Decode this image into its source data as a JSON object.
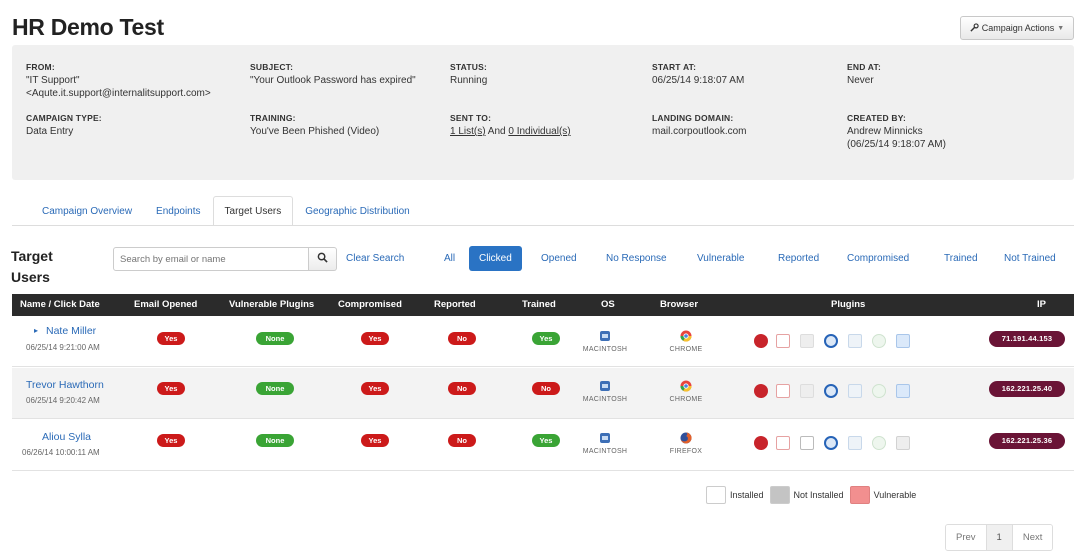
{
  "page": {
    "title": "HR Demo Test",
    "actions_label": "Campaign Actions"
  },
  "info": {
    "from_label": "FROM:",
    "from_value_1": "\"IT Support\"",
    "from_value_2": "<Aqute.it.support@internalitsupport.com>",
    "subject_label": "SUBJECT:",
    "subject_value": "\"Your Outlook Password has expired\"",
    "status_label": "STATUS:",
    "status_value": "Running",
    "start_label": "START AT:",
    "start_value": "06/25/14 9:18:07 AM",
    "end_label": "END AT:",
    "end_value": "Never",
    "type_label": "CAMPAIGN TYPE:",
    "type_value": "Data Entry",
    "training_label": "TRAINING:",
    "training_value": "You've Been Phished (Video)",
    "sent_label": "SENT TO:",
    "sent_lists": "1 List(s)",
    "sent_and": " And ",
    "sent_individuals": "0 Individual(s)",
    "landing_label": "LANDING DOMAIN:",
    "landing_value": "mail.corpoutlook.com",
    "created_label": "CREATED BY:",
    "created_by": "Andrew Minnicks",
    "created_at": "(06/25/14 9:18:07 AM)"
  },
  "tabs": [
    "Campaign Overview",
    "Endpoints",
    "Target Users",
    "Geographic Distribution"
  ],
  "target_users": {
    "title_line1": "Target",
    "title_line2": "Users",
    "search_placeholder": "Search by email or name",
    "clear_label": "Clear Search",
    "filters": [
      "All",
      "Clicked",
      "Opened",
      "No Response",
      "Vulnerable",
      "Reported",
      "Compromised",
      "Trained",
      "Not Trained"
    ]
  },
  "table": {
    "headers": [
      "Name / Click Date",
      "Email Opened",
      "Vulnerable Plugins",
      "Compromised",
      "Reported",
      "Trained",
      "OS",
      "Browser",
      "Plugins",
      "IP"
    ],
    "rows": [
      {
        "expand": "▸",
        "name": "Nate Miller",
        "date": "06/25/14 9:21:00 AM",
        "opened": "Yes",
        "vuln": "None",
        "compromised": "Yes",
        "reported": "No",
        "trained": "Yes",
        "trained_color": "green",
        "os": "MACINTOSH",
        "browser": "CHROME",
        "browser_icon": "chrome-icon",
        "ip": "71.191.44.153"
      },
      {
        "expand": "",
        "name": "Trevor Hawthorn",
        "date": "06/25/14 9:20:42 AM",
        "opened": "Yes",
        "vuln": "None",
        "compromised": "Yes",
        "reported": "No",
        "trained": "No",
        "trained_color": "red",
        "os": "MACINTOSH",
        "browser": "CHROME",
        "browser_icon": "chrome-icon",
        "ip": "162.221.25.40"
      },
      {
        "expand": "",
        "name": "Aliou Sylla",
        "date": "06/26/14 10:00:11 AM",
        "opened": "Yes",
        "vuln": "None",
        "compromised": "Yes",
        "reported": "No",
        "trained": "Yes",
        "trained_color": "green",
        "os": "MACINTOSH",
        "browser": "FIREFOX",
        "browser_icon": "firefox-icon",
        "ip": "162.221.25.36"
      }
    ]
  },
  "legend": {
    "installed": "Installed",
    "not_installed": "Not Installed",
    "vulnerable": "Vulnerable"
  },
  "pager": {
    "prev": "Prev",
    "current": "1",
    "next": "Next"
  },
  "colors": {
    "link": "#2a6ab7",
    "active_tab_bg": "#2a73c4",
    "yes_red": "#cc1a1a",
    "green": "#3aa435",
    "ip_badge": "#6a1436",
    "header_bg": "#2b2b2b",
    "vulnerable_swatch": "#f28f8f",
    "not_installed_swatch": "#c4c4c4"
  }
}
